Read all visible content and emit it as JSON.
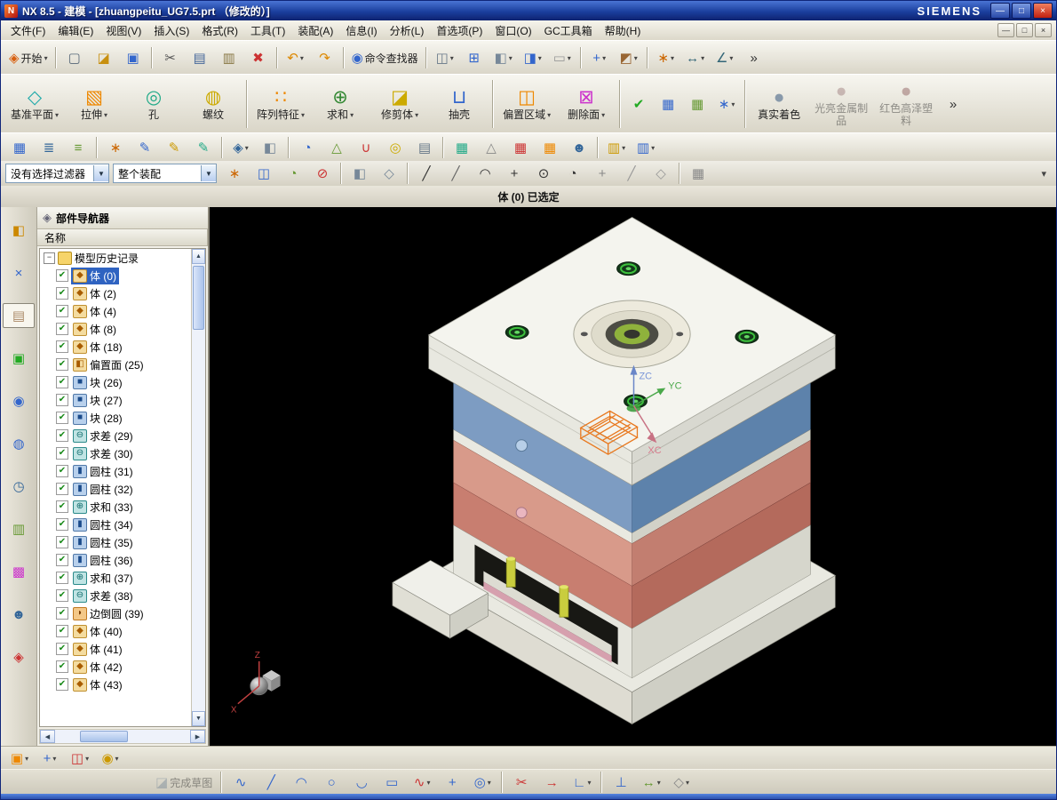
{
  "window": {
    "title": "NX 8.5 - 建模 - [zhuangpeitu_UG7.5.prt （修改的）]",
    "brand": "SIEMENS",
    "controls": [
      {
        "name": "minimize-button",
        "glyph": "—"
      },
      {
        "name": "restore-button",
        "glyph": "□"
      },
      {
        "name": "close-button",
        "glyph": "×",
        "close": true
      }
    ],
    "mdi_controls": [
      {
        "name": "mdi-minimize-button",
        "glyph": "—"
      },
      {
        "name": "mdi-restore-button",
        "glyph": "□"
      },
      {
        "name": "mdi-close-button",
        "glyph": "×"
      }
    ]
  },
  "menus": [
    {
      "name": "menu-file",
      "label": "文件(F)"
    },
    {
      "name": "menu-edit",
      "label": "编辑(E)"
    },
    {
      "name": "menu-view",
      "label": "视图(V)"
    },
    {
      "name": "menu-insert",
      "label": "插入(S)"
    },
    {
      "name": "menu-format",
      "label": "格式(R)"
    },
    {
      "name": "menu-tools",
      "label": "工具(T)"
    },
    {
      "name": "menu-assemblies",
      "label": "装配(A)"
    },
    {
      "name": "menu-information",
      "label": "信息(I)"
    },
    {
      "name": "menu-analysis",
      "label": "分析(L)"
    },
    {
      "name": "menu-preferences",
      "label": "首选项(P)"
    },
    {
      "name": "menu-window",
      "label": "窗口(O)"
    },
    {
      "name": "menu-gc-toolbox",
      "label": "GC工具箱"
    },
    {
      "name": "menu-help",
      "label": "帮助(H)"
    }
  ],
  "ui": {
    "dropdown_glyph": "▾",
    "check_glyph": "✔",
    "collapse_glyph": "−",
    "combo_arrow_glyph": "▼"
  },
  "colors": {
    "selection_highlight": "#2f63c1",
    "viewport_background": "#000000",
    "plate_blue": "#7d9cc2",
    "plate_salmon": "#d89a8a",
    "plate_red": "#c87e70",
    "pin_yellow": "#c9cd3e",
    "wireframe_orange": "#e8781e",
    "axis_z": "#6a86c8",
    "axis_y": "#4aa84a",
    "axis_x": "#c87284"
  },
  "toolbars": {
    "row1": [
      {
        "name": "start-button",
        "label": "开始",
        "glyph": "◈",
        "color": "#d86010",
        "dd": true
      },
      {
        "sep": true
      },
      {
        "name": "new-file-button",
        "glyph": "▢",
        "color": "#567"
      },
      {
        "name": "open-button",
        "glyph": "◪",
        "color": "#c89010"
      },
      {
        "name": "save-button",
        "glyph": "▣",
        "color": "#3366cc"
      },
      {
        "sep": true
      },
      {
        "name": "cut-button",
        "glyph": "✂",
        "color": "#555"
      },
      {
        "name": "copy-button",
        "glyph": "▤",
        "color": "#446699"
      },
      {
        "name": "paste-button",
        "glyph": "▥",
        "color": "#887744"
      },
      {
        "name": "delete-button",
        "glyph": "✖",
        "color": "#cc3333"
      },
      {
        "sep": true
      },
      {
        "name": "undo-button",
        "glyph": "↶",
        "color": "#dd8800",
        "dd": true
      },
      {
        "name": "redo-button",
        "glyph": "↷",
        "color": "#dd8800"
      },
      {
        "sep": true
      },
      {
        "name": "command-finder-button",
        "label": "命令查找器",
        "glyph": "◉",
        "color": "#3366cc"
      },
      {
        "sep": true
      },
      {
        "name": "touch-mode-button",
        "glyph": "◫",
        "color": "#667788",
        "dd": true
      },
      {
        "name": "fit-view-button",
        "glyph": "⊞",
        "color": "#3366cc"
      },
      {
        "name": "orient-view-button",
        "glyph": "◧",
        "color": "#778899",
        "dd": true
      },
      {
        "name": "rendering-style-button",
        "glyph": "◨",
        "color": "#3366cc",
        "dd": true
      },
      {
        "name": "background-button",
        "glyph": "▭",
        "color": "#999",
        "dd": true
      },
      {
        "sep": true
      },
      {
        "name": "show-hide-button",
        "glyph": "+",
        "color": "#3366cc",
        "dd": true
      },
      {
        "name": "edit-object-display-button",
        "glyph": "◩",
        "color": "#996633",
        "dd": true
      },
      {
        "sep": true
      },
      {
        "name": "snap-point-toggle-button",
        "glyph": "∗",
        "color": "#cc6600",
        "dd": true
      },
      {
        "name": "measure-distance-button",
        "glyph": "↔",
        "color": "#336677",
        "dd": true
      },
      {
        "name": "measure-angle-button",
        "glyph": "∠",
        "color": "#336677",
        "dd": true
      },
      {
        "name": "toolbar-overflow-chevron",
        "glyph": "»",
        "color": "#333"
      }
    ],
    "features": [
      {
        "name": "datum-plane-button",
        "label": "基准平面",
        "glyph": "◇",
        "color": "#22aaaa",
        "dd": true
      },
      {
        "name": "extrude-button",
        "label": "拉伸",
        "glyph": "▧",
        "color": "#ee8800",
        "dd": true
      },
      {
        "name": "hole-button",
        "label": "孔",
        "glyph": "◎",
        "color": "#22aa88"
      },
      {
        "name": "thread-button",
        "label": "螺纹",
        "glyph": "◍",
        "color": "#ccaa00"
      },
      {
        "sep": true
      },
      {
        "name": "pattern-feature-button",
        "label": "阵列特征",
        "glyph": "∷",
        "color": "#ee8800",
        "dd": true
      },
      {
        "name": "unite-button",
        "label": "求和",
        "glyph": "⊕",
        "color": "#338833",
        "dd": true
      },
      {
        "name": "trim-body-button",
        "label": "修剪体",
        "glyph": "◪",
        "color": "#ccaa00",
        "dd": true
      },
      {
        "name": "shell-button",
        "label": "抽壳",
        "glyph": "⊔",
        "color": "#3366cc"
      },
      {
        "sep": true
      },
      {
        "name": "offset-region-button",
        "label": "偏置区域",
        "glyph": "◫",
        "color": "#ee8800",
        "dd": true
      },
      {
        "name": "delete-face-button",
        "label": "删除面",
        "glyph": "⊠",
        "color": "#cc33cc",
        "dd": true
      },
      {
        "sep": true
      },
      {
        "name": "check-feature-button",
        "glyph": "✔",
        "color": "#22aa22",
        "small": true
      },
      {
        "name": "expression-table-button",
        "glyph": "▦",
        "color": "#3366cc",
        "small": true
      },
      {
        "name": "part-family-table-button",
        "glyph": "▦",
        "color": "#669933",
        "small": true
      },
      {
        "name": "csys-tool-button",
        "glyph": "∗",
        "color": "#3366cc",
        "small": true,
        "dd": true
      },
      {
        "sep": true
      },
      {
        "name": "true-shading-button",
        "label": "真实着色",
        "glyph": "●",
        "color": "#8899aa"
      },
      {
        "name": "shiny-metal-material-button",
        "label": "光亮金属制品",
        "glyph": "●",
        "color": "#997777",
        "disabled": true
      },
      {
        "name": "red-gloss-plastic-button",
        "label": "红色高泽塑料",
        "glyph": "●",
        "color": "#885555",
        "disabled": true
      },
      {
        "name": "feature-overflow-chevron",
        "glyph": "»",
        "color": "#333",
        "small": true
      }
    ],
    "row3": [
      {
        "name": "section-view-button",
        "glyph": "▦",
        "color": "#3366cc"
      },
      {
        "name": "layer-settings-button",
        "glyph": "≣",
        "color": "#336699"
      },
      {
        "name": "view-in-layer-button",
        "glyph": "≡",
        "color": "#669933"
      },
      {
        "sep": true
      },
      {
        "name": "wcs-dynamics-button",
        "glyph": "∗",
        "color": "#cc6600"
      },
      {
        "name": "object-display-pencil-button",
        "glyph": "✎",
        "color": "#3366cc"
      },
      {
        "name": "show-hide-pencil-button",
        "glyph": "✎",
        "color": "#cc9900"
      },
      {
        "name": "immediate-hide-pencil-button",
        "glyph": "✎",
        "color": "#22aa88"
      },
      {
        "sep": true
      },
      {
        "name": "interpart-link-button",
        "glyph": "◈",
        "color": "#336699",
        "dd": true
      },
      {
        "name": "view-cube-button",
        "glyph": "◧",
        "color": "#778899"
      },
      {
        "sep": true
      },
      {
        "name": "information-button",
        "glyph": "◔",
        "color": "#3366cc"
      },
      {
        "name": "analysis-triangle-button",
        "glyph": "△",
        "color": "#669933"
      },
      {
        "name": "magnet-tool-button",
        "glyph": "∪",
        "color": "#cc3333"
      },
      {
        "name": "ring-tool-button",
        "glyph": "◎",
        "color": "#ccaa00"
      },
      {
        "name": "chip-tool-button",
        "glyph": "▤",
        "color": "#667788"
      },
      {
        "sep": true
      },
      {
        "name": "spreadsheet-button",
        "glyph": "▦",
        "color": "#22aa88"
      },
      {
        "name": "tolerance-button",
        "glyph": "△",
        "color": "#888"
      },
      {
        "name": "red-table-button",
        "glyph": "▦",
        "color": "#cc3333"
      },
      {
        "name": "orange-table-button",
        "glyph": "▦",
        "color": "#ee8800"
      },
      {
        "name": "user-group-button",
        "glyph": "☻",
        "color": "#336699"
      },
      {
        "sep": true
      },
      {
        "name": "reuse-library-gold-button",
        "glyph": "▥",
        "color": "#cc9900",
        "dd": true
      },
      {
        "name": "reuse-library-blue-button",
        "glyph": "▥",
        "color": "#3366cc",
        "dd": true
      }
    ]
  },
  "selection_bar": {
    "filter_value": "没有选择过滤器",
    "scope_value": "整个装配",
    "more_glyph": "▾",
    "icons": [
      {
        "name": "snap-preview-button",
        "glyph": "∗",
        "color": "#cc6600"
      },
      {
        "name": "select-all-button",
        "glyph": "◫",
        "color": "#3366cc"
      },
      {
        "name": "highlight-select-button",
        "glyph": "◔",
        "color": "#669933"
      },
      {
        "name": "deselect-all-button",
        "glyph": "⊘",
        "color": "#cc3333"
      },
      {
        "sep": true
      },
      {
        "name": "shaded-locate-button",
        "glyph": "◧",
        "color": "#778899"
      },
      {
        "name": "wireframe-locate-button",
        "glyph": "◇",
        "color": "#778899"
      },
      {
        "sep": true
      },
      {
        "name": "snap-endpoint-button",
        "glyph": "╱",
        "color": "#333"
      },
      {
        "name": "snap-midpoint-button",
        "glyph": "╱",
        "color": "#666"
      },
      {
        "name": "snap-control-point-button",
        "glyph": "◠",
        "color": "#333"
      },
      {
        "name": "snap-intersection-button",
        "glyph": "+",
        "color": "#333"
      },
      {
        "name": "snap-arc-center-button",
        "glyph": "⊙",
        "color": "#333"
      },
      {
        "name": "snap-quadrant-button",
        "glyph": "◔",
        "color": "#333"
      },
      {
        "name": "snap-existing-point-button",
        "glyph": "+",
        "color": "#888"
      },
      {
        "name": "snap-point-on-curve-button",
        "glyph": "╱",
        "color": "#999"
      },
      {
        "name": "snap-point-on-face-button",
        "glyph": "◇",
        "color": "#999"
      },
      {
        "sep": true
      },
      {
        "name": "work-grid-button",
        "glyph": "▦",
        "color": "#888"
      }
    ]
  },
  "status": "体 (0) 已选定",
  "resource_bar": [
    {
      "name": "assembly-navigator-tab",
      "glyph": "◧",
      "color": "#cc8800"
    },
    {
      "name": "constraint-navigator-tab",
      "glyph": "×",
      "color": "#3366cc"
    },
    {
      "name": "part-navigator-tab",
      "glyph": "▤",
      "color": "#aa8866",
      "active": true
    },
    {
      "name": "reuse-library-tab",
      "glyph": "▣",
      "color": "#22aa22"
    },
    {
      "name": "hd3d-tools-tab",
      "glyph": "◉",
      "color": "#3366cc"
    },
    {
      "name": "web-browser-tab",
      "glyph": "◍",
      "color": "#3366cc"
    },
    {
      "name": "history-tab",
      "glyph": "◷",
      "color": "#336699"
    },
    {
      "name": "process-studio-tab",
      "glyph": "▥",
      "color": "#669933"
    },
    {
      "name": "palettes-tab",
      "glyph": "▩",
      "color": "#cc33cc"
    },
    {
      "name": "roles-tab",
      "glyph": "☻",
      "color": "#336699"
    },
    {
      "name": "resource-options-tab",
      "glyph": "◈",
      "color": "#cc3333"
    }
  ],
  "navigator": {
    "title": "部件导航器",
    "column": "名称",
    "root": "模型历史记录",
    "type_glyphs": {
      "body": "◆",
      "offset": "◧",
      "block": "■",
      "subtract": "⊖",
      "unite": "⊕",
      "cylinder": "▮",
      "blend": "◗"
    },
    "items": [
      {
        "label": "体 (0)",
        "type": "body",
        "selected": true
      },
      {
        "label": "体 (2)",
        "type": "body"
      },
      {
        "label": "体 (4)",
        "type": "body"
      },
      {
        "label": "体 (8)",
        "type": "body"
      },
      {
        "label": "体 (18)",
        "type": "body"
      },
      {
        "label": "偏置面 (25)",
        "type": "offset"
      },
      {
        "label": "块 (26)",
        "type": "block"
      },
      {
        "label": "块 (27)",
        "type": "block"
      },
      {
        "label": "块 (28)",
        "type": "block"
      },
      {
        "label": "求差 (29)",
        "type": "subtract"
      },
      {
        "label": "求差 (30)",
        "type": "subtract"
      },
      {
        "label": "圆柱 (31)",
        "type": "cylinder"
      },
      {
        "label": "圆柱 (32)",
        "type": "cylinder"
      },
      {
        "label": "求和 (33)",
        "type": "unite"
      },
      {
        "label": "圆柱 (34)",
        "type": "cylinder"
      },
      {
        "label": "圆柱 (35)",
        "type": "cylinder"
      },
      {
        "label": "圆柱 (36)",
        "type": "cylinder"
      },
      {
        "label": "求和 (37)",
        "type": "unite"
      },
      {
        "label": "求差 (38)",
        "type": "subtract"
      },
      {
        "label": "边倒圆 (39)",
        "type": "blend"
      },
      {
        "label": "体 (40)",
        "type": "body"
      },
      {
        "label": "体 (41)",
        "type": "body"
      },
      {
        "label": "体 (42)",
        "type": "body"
      },
      {
        "label": "体 (43)",
        "type": "body"
      }
    ]
  },
  "viewport": {
    "axis_labels": {
      "zc": "ZC",
      "yc": "YC",
      "xc": "XC"
    },
    "triad": {
      "x": "X",
      "z": "Z"
    }
  },
  "bottom": {
    "rowA": [
      {
        "name": "sketch-task-button",
        "glyph": "▣",
        "color": "#ee8800",
        "dd": true
      },
      {
        "name": "datum-csys-button",
        "glyph": "+",
        "color": "#3366cc",
        "dd": true
      },
      {
        "name": "swap-view-button",
        "glyph": "◫",
        "color": "#cc3333",
        "dd": true
      },
      {
        "name": "tools-gold-button",
        "glyph": "◉",
        "color": "#cc9900",
        "dd": true
      }
    ],
    "rowB": [
      {
        "name": "finish-sketch-button",
        "label": "完成草图",
        "glyph": "◪",
        "color": "#778899",
        "disabled": true
      },
      {
        "sep": true
      },
      {
        "name": "profile-button",
        "glyph": "∿",
        "color": "#3366cc"
      },
      {
        "name": "line-button",
        "glyph": "╱",
        "color": "#3366cc"
      },
      {
        "name": "arc-button",
        "glyph": "◠",
        "color": "#3366cc"
      },
      {
        "name": "circle-button",
        "glyph": "○",
        "color": "#3366cc"
      },
      {
        "name": "fillet-button",
        "glyph": "◡",
        "color": "#3366cc"
      },
      {
        "name": "rectangle-button",
        "glyph": "▭",
        "color": "#3366cc"
      },
      {
        "name": "studio-spline-button",
        "glyph": "∿",
        "color": "#cc3333",
        "dd": true
      },
      {
        "name": "point-button",
        "glyph": "+",
        "color": "#3366cc"
      },
      {
        "name": "offset-curve-button",
        "glyph": "◎",
        "color": "#3366cc",
        "dd": true
      },
      {
        "sep": true
      },
      {
        "name": "quick-trim-button",
        "glyph": "✂",
        "color": "#cc3333"
      },
      {
        "name": "quick-extend-button",
        "glyph": "→",
        "color": "#cc3333"
      },
      {
        "name": "make-corner-button",
        "glyph": "∟",
        "color": "#3366cc",
        "dd": true
      },
      {
        "sep": true
      },
      {
        "name": "geometric-constraints-button",
        "glyph": "⊥",
        "color": "#3366cc"
      },
      {
        "name": "auto-dimension-button",
        "glyph": "↔",
        "color": "#669933",
        "dd": true
      },
      {
        "name": "more-sketch-button",
        "glyph": "◇",
        "color": "#888",
        "dd": true
      }
    ]
  }
}
